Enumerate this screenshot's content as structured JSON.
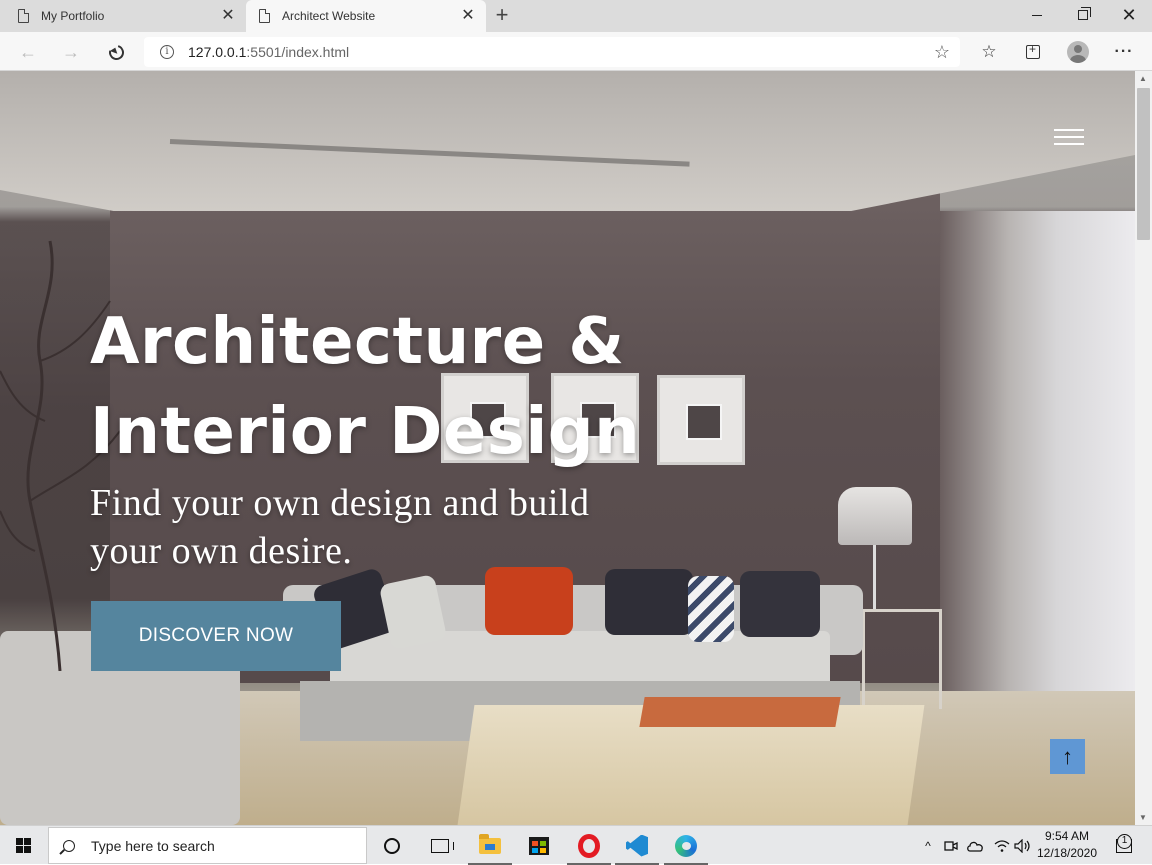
{
  "browser": {
    "tabs": [
      {
        "label": "My Portfolio",
        "icon": "page-icon",
        "active": false
      },
      {
        "label": "Architect Website",
        "icon": "page-icon",
        "active": true
      }
    ],
    "close_glyph": "✕",
    "new_tab_glyph": "+",
    "window_controls": {
      "minimize": "minimize-icon",
      "maximize": "restore-icon",
      "close_glyph": "✕"
    },
    "address": {
      "host": "127.0.0.1",
      "rest": ":5501/index.html",
      "info_glyph": "i",
      "favorite_glyph": "☆"
    },
    "nav": {
      "back_glyph": "←",
      "forward_glyph": "→"
    },
    "toolbar_icons": [
      "favorites-icon",
      "collections-icon",
      "profile-icon",
      "more-icon"
    ],
    "more_glyph": "···",
    "favorites_glyph": "☆"
  },
  "page": {
    "hero_title_line1": "Architecture &",
    "hero_title_line2": "Interior Design",
    "hero_subtitle_line1": "Find your own design and build",
    "hero_subtitle_line2": "your own desire.",
    "cta_label": "DISCOVER NOW",
    "back_to_top_glyph": "↑",
    "accent_color": "#55859e",
    "back_to_top_color": "#5f97d4"
  },
  "scrollbar": {
    "up_glyph": "▲",
    "down_glyph": "▼"
  },
  "taskbar": {
    "search_placeholder": "Type here to search",
    "apps": [
      "cortana-icon",
      "task-view-icon",
      "file-explorer-icon",
      "store-icon",
      "opera-icon",
      "vscode-icon",
      "edge-icon"
    ],
    "tray": {
      "chevron_glyph": "^",
      "time": "9:54 AM",
      "date": "12/18/2020",
      "notification_count": "1"
    }
  }
}
